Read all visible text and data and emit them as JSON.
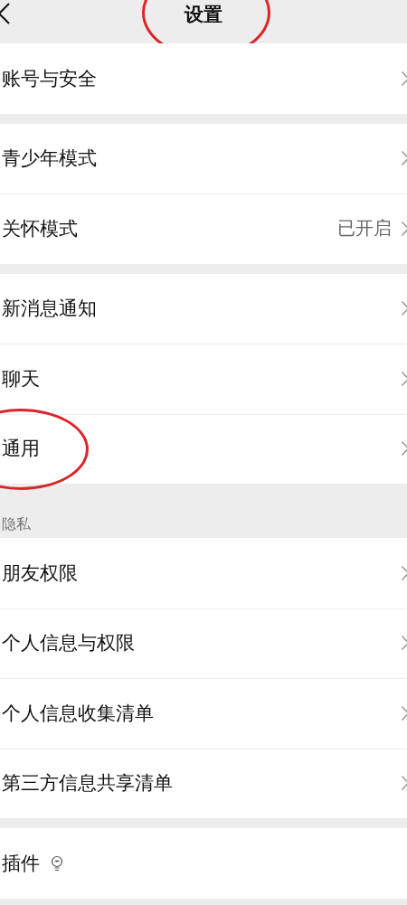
{
  "header": {
    "title": "设置",
    "circled": true
  },
  "sections": [
    {
      "items": [
        {
          "label": "账号与安全",
          "circled": false
        }
      ]
    },
    {
      "items": [
        {
          "label": "青少年模式",
          "circled": false
        },
        {
          "label": "关怀模式",
          "value": "已开启",
          "circled": false
        }
      ]
    },
    {
      "items": [
        {
          "label": "新消息通知",
          "circled": false
        },
        {
          "label": "聊天",
          "circled": false
        },
        {
          "label": "通用",
          "circled": true
        }
      ]
    },
    {
      "title": "隐私",
      "items": [
        {
          "label": "朋友权限",
          "circled": false
        },
        {
          "label": "个人信息与权限",
          "circled": false
        },
        {
          "label": "个人信息收集清单",
          "circled": false
        },
        {
          "label": "第三方信息共享清单",
          "circled": false
        }
      ]
    },
    {
      "items": [
        {
          "label": "插件",
          "kind": "bulb",
          "circled": false
        }
      ]
    }
  ]
}
